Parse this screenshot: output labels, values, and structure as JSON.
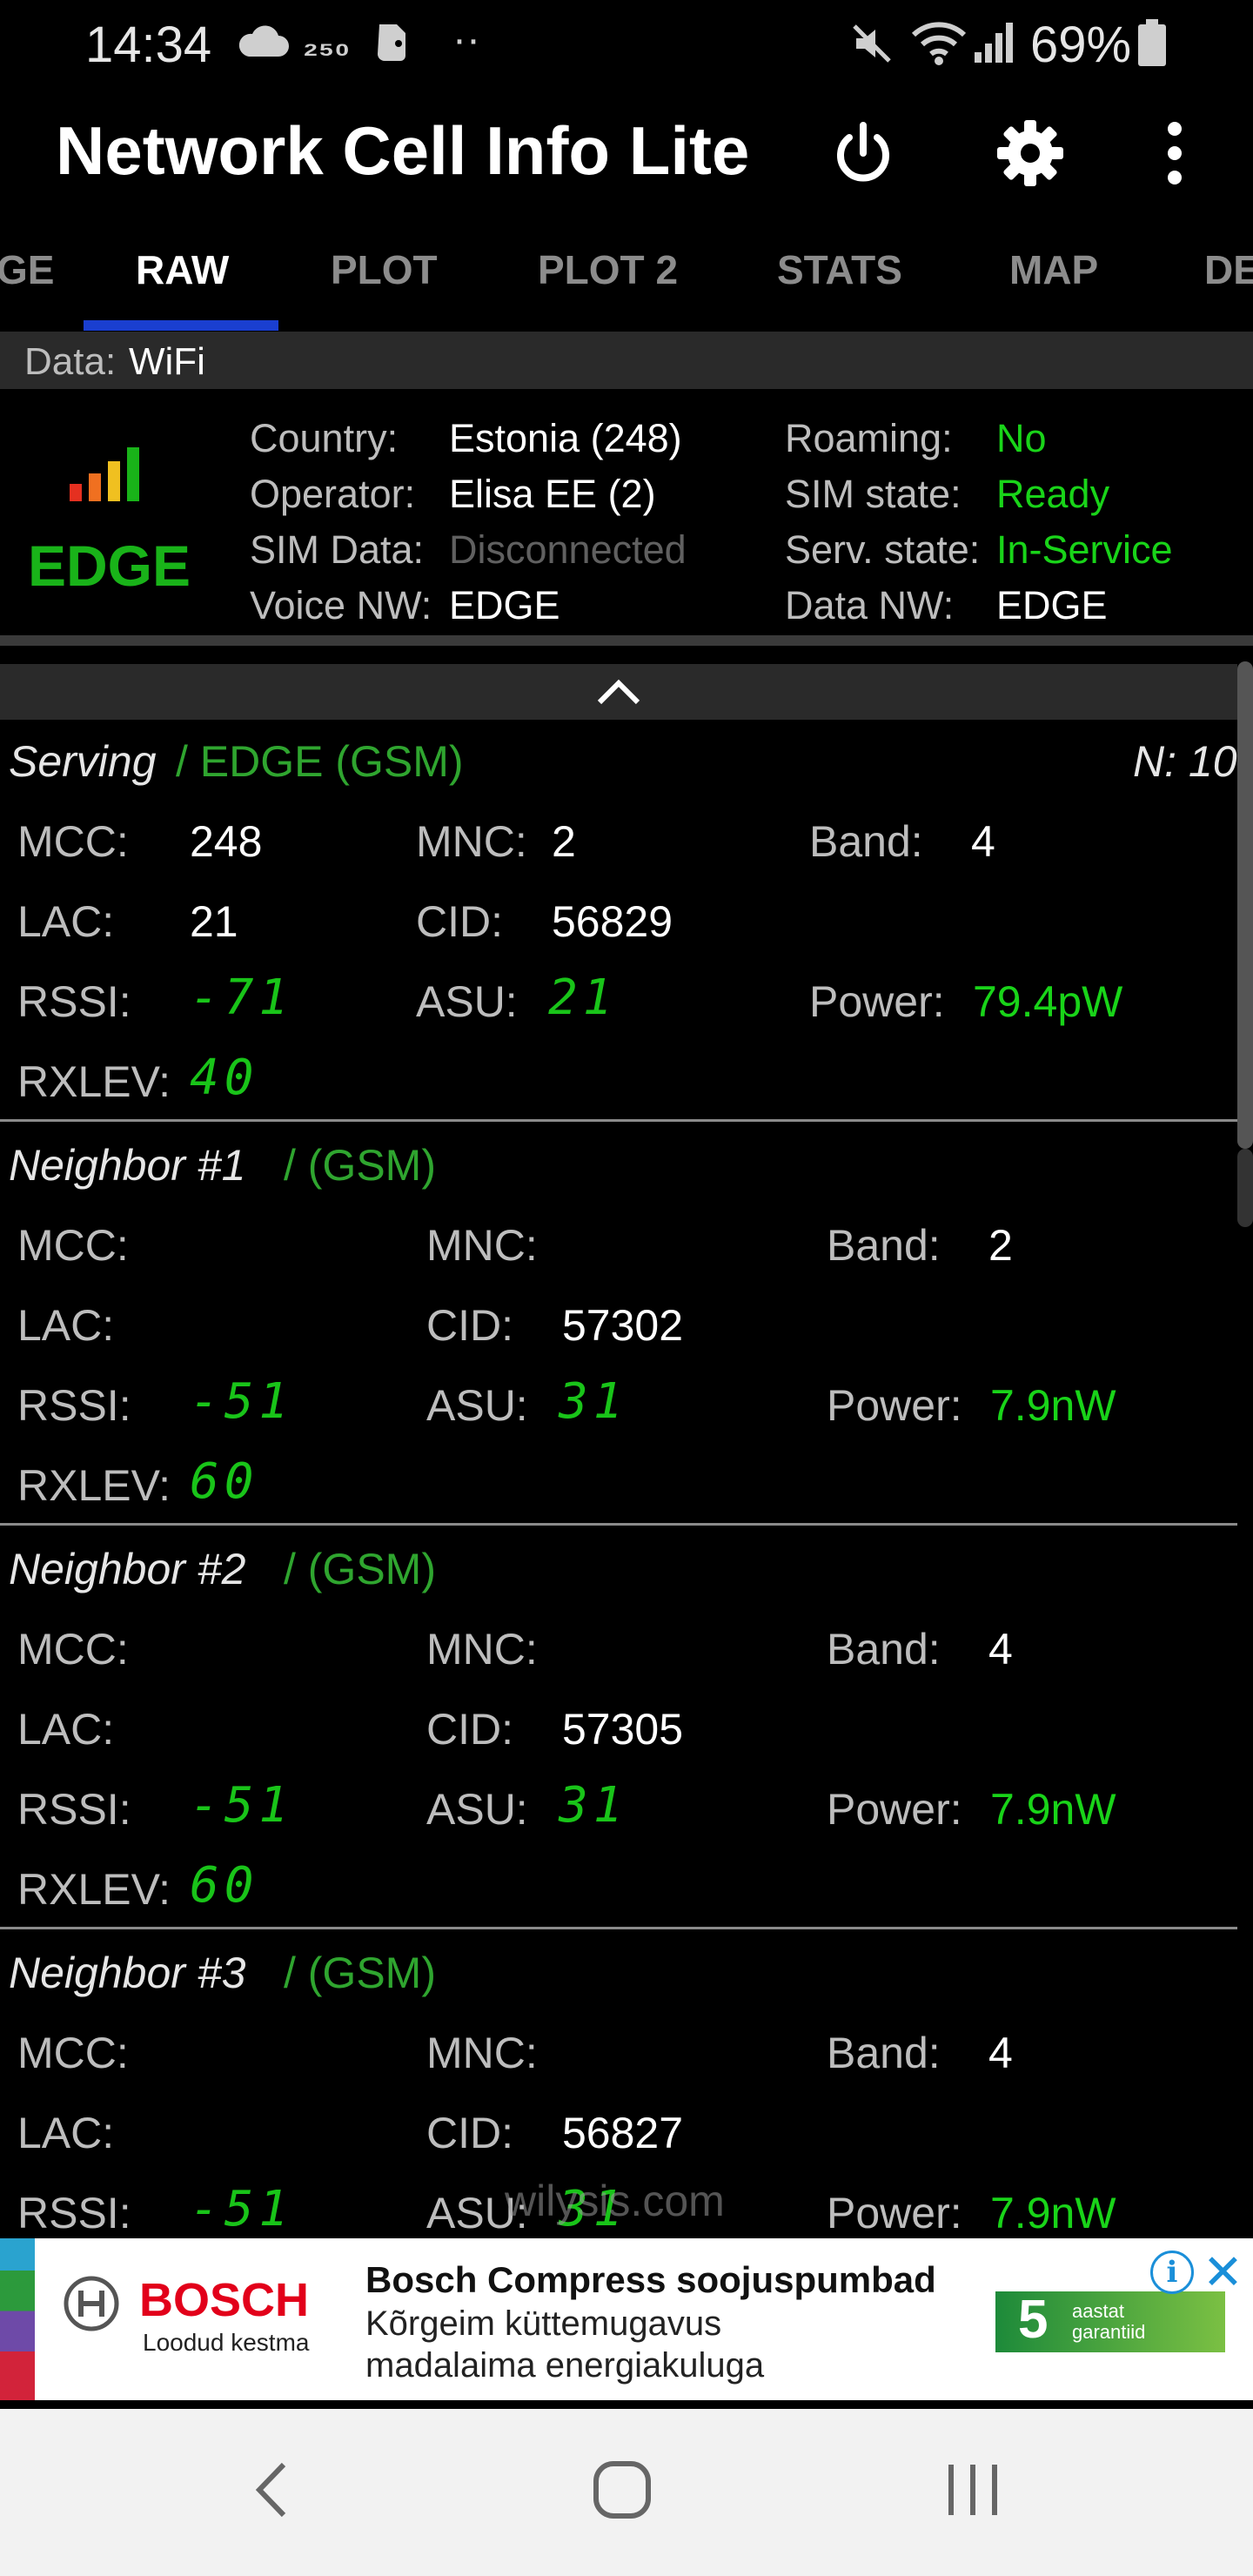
{
  "status_bar": {
    "time": "14:34",
    "icons": [
      "cloud-icon",
      "data-saver-icon",
      "evernote-icon",
      "more-dots-icon",
      "mute-icon",
      "wifi-icon",
      "signal-icon",
      "battery-icon"
    ],
    "battery": "69%"
  },
  "app_bar": {
    "title": "Network Cell Info Lite",
    "actions": [
      "power-icon",
      "settings-icon",
      "overflow-menu-icon"
    ]
  },
  "tabs": [
    "GE",
    "RAW",
    "PLOT",
    "PLOT 2",
    "STATS",
    "MAP",
    "DE"
  ],
  "active_tab": "RAW",
  "data_row": {
    "label": "Data:",
    "value": "WiFi"
  },
  "network_info": {
    "network_type": "EDGE",
    "country_label": "Country:",
    "country": "Estonia (248)",
    "operator_label": "Operator:",
    "operator": "Elisa EE (2)",
    "sim_data_label": "SIM Data:",
    "sim_data": "Disconnected",
    "voice_nw_label": "Voice NW:",
    "voice_nw": "EDGE",
    "roaming_label": "Roaming:",
    "roaming": "No",
    "sim_state_label": "SIM state:",
    "sim_state": "Ready",
    "serv_state_label": "Serv. state:",
    "serv_state": "In-Service",
    "data_nw_label": "Data NW:",
    "data_nw": "EDGE"
  },
  "labels": {
    "mcc": "MCC:",
    "mnc": "MNC:",
    "band": "Band:",
    "lac": "LAC:",
    "cid": "CID:",
    "rssi": "RSSI:",
    "asu": "ASU:",
    "power": "Power:",
    "rxlev": "RXLEV:"
  },
  "serving": {
    "title": "Serving",
    "type": "/ EDGE (GSM)",
    "n": "N: 10",
    "mcc": "248",
    "mnc": "2",
    "band": "4",
    "lac": "21",
    "cid": "56829",
    "rssi": "-71",
    "asu": "21",
    "power": "79.4pW",
    "rxlev": "40"
  },
  "neighbors": [
    {
      "title": "Neighbor #1",
      "type": "/ (GSM)",
      "mcc": "",
      "mnc": "",
      "band": "2",
      "lac": "",
      "cid": "57302",
      "rssi": "-51",
      "asu": "31",
      "power": "7.9nW",
      "rxlev": "60"
    },
    {
      "title": "Neighbor #2",
      "type": "/ (GSM)",
      "mcc": "",
      "mnc": "",
      "band": "4",
      "lac": "",
      "cid": "57305",
      "rssi": "-51",
      "asu": "31",
      "power": "7.9nW",
      "rxlev": "60"
    },
    {
      "title": "Neighbor #3",
      "type": "/ (GSM)",
      "mcc": "",
      "mnc": "",
      "band": "4",
      "lac": "",
      "cid": "56827",
      "rssi": "-51",
      "asu": "31",
      "power": "7.9nW"
    }
  ],
  "watermark": "wilysis.com",
  "ad": {
    "brand": "BOSCH",
    "tagline": "Loodud kestma",
    "title": "Bosch Compress soojuspumbad",
    "line1": "Kõrgeim küttemugavus",
    "line2": "madalaima energiakuluga",
    "badge_number": "5",
    "badge_line1": "aastat",
    "badge_line2": "garantiid"
  },
  "nav_bar": [
    "back-icon",
    "home-icon",
    "recents-icon"
  ]
}
